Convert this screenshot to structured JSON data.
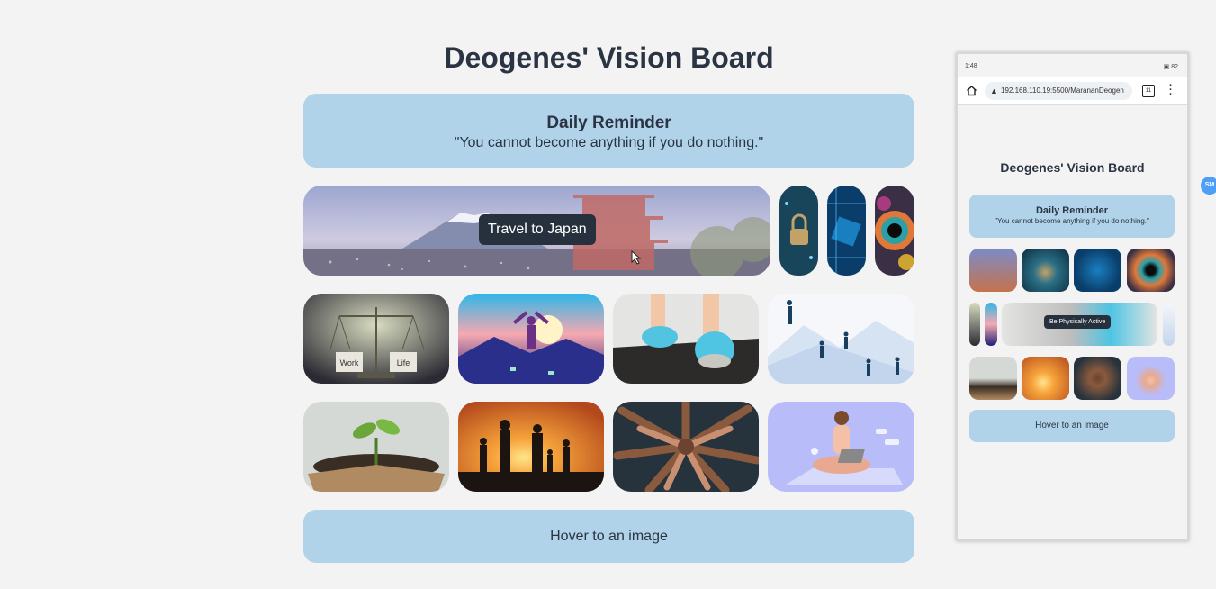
{
  "board": {
    "title": "Deogenes' Vision Board",
    "reminder_heading": "Daily Reminder",
    "reminder_quote": "\"You cannot become anything if you do nothing.\"",
    "tooltip": "Travel to Japan",
    "hover_text": "Hover to an image",
    "images": [
      {
        "name": "japan-fuji-pagoda"
      },
      {
        "name": "padlock-circuit"
      },
      {
        "name": "blue-chip"
      },
      {
        "name": "colorful-eye"
      },
      {
        "name": "work-life-balance-scale"
      },
      {
        "name": "breaking-chains"
      },
      {
        "name": "running-shoes-treadmill"
      },
      {
        "name": "climbing-mountain"
      },
      {
        "name": "sprout-on-book"
      },
      {
        "name": "family-sunset"
      },
      {
        "name": "hands-together"
      },
      {
        "name": "meditation-laptop"
      }
    ],
    "scale_labels": [
      "Work",
      "Life"
    ]
  },
  "phone": {
    "status_time": "1:48",
    "status_right": "▣ 82",
    "url": "192.168.110.19:5500/MarananDeogen",
    "tab_count": "11",
    "title": "Deogenes' Vision Board",
    "reminder_heading": "Daily Reminder",
    "reminder_quote": "\"You cannot become anything if you do nothing.\"",
    "tooltip": "Be Physically Active",
    "hover_text": "Hover to an image"
  },
  "extension_badge": "SM"
}
